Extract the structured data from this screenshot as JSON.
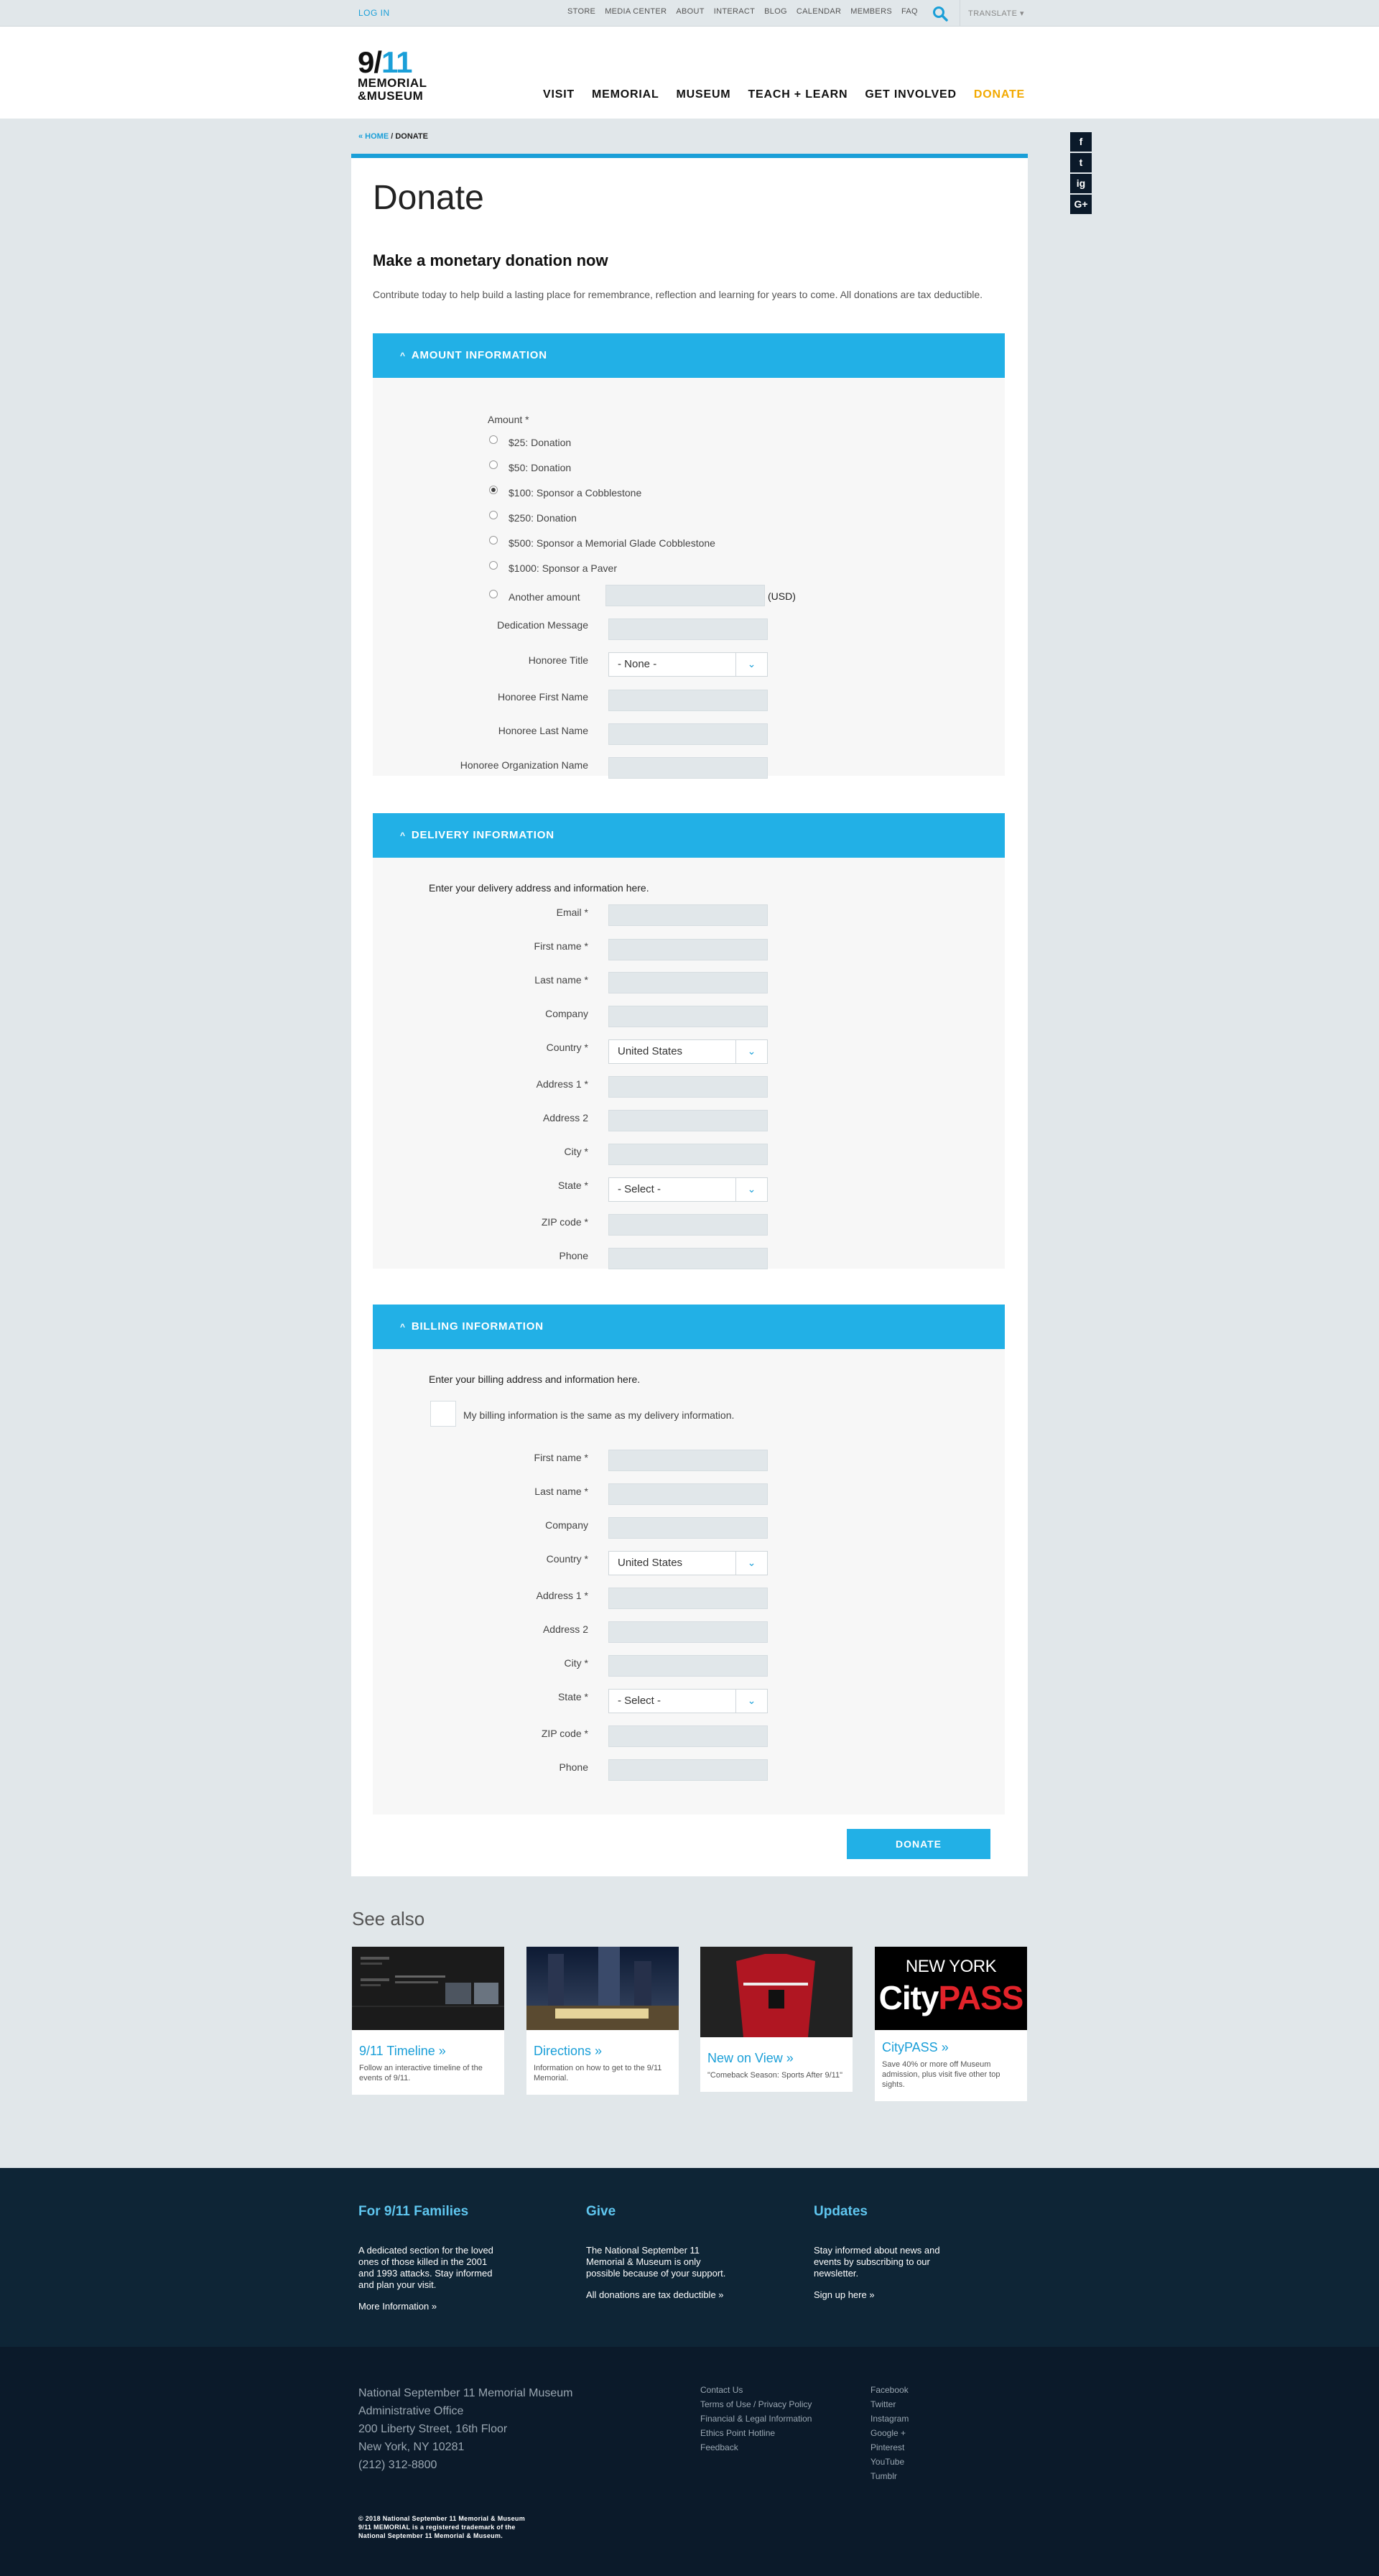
{
  "topbar": {
    "login": "LOG IN",
    "links": [
      "STORE",
      "MEDIA CENTER",
      "ABOUT",
      "INTERACT",
      "BLOG",
      "CALENDAR",
      "MEMBERS",
      "FAQ"
    ],
    "translate": "TRANSLATE ▾"
  },
  "logo": {
    "line1_a": "9/",
    "line1_b": "11",
    "line2": "MEMORIAL",
    "line3": "&MUSEUM"
  },
  "nav": [
    "VISIT",
    "MEMORIAL",
    "MUSEUM",
    "TEACH + LEARN",
    "GET INVOLVED"
  ],
  "nav_donate": "DONATE",
  "social": [
    "f",
    "t",
    "ig",
    "G+"
  ],
  "breadcrumb": {
    "home": "« HOME",
    "sep": " / ",
    "current": "DONATE"
  },
  "page": {
    "title": "Donate",
    "subtitle": "Make a monetary donation now",
    "intro": "Contribute today to help build a lasting place for remembrance, reflection and learning for years to come. All donations are tax deductible."
  },
  "amount": {
    "header": "AMOUNT INFORMATION",
    "label": "Amount *",
    "options": [
      "$25: Donation",
      "$50: Donation",
      "$100: Sponsor a Cobblestone",
      "$250: Donation",
      "$500: Sponsor a Memorial Glade Cobblestone",
      "$1000: Sponsor a Paver",
      "Another amount"
    ],
    "selected_index": 2,
    "currency": "(USD)",
    "dedication": "Dedication Message",
    "honoree_title": "Honoree Title",
    "honoree_title_value": "- None -",
    "honoree_first": "Honoree First Name",
    "honoree_last": "Honoree Last Name",
    "honoree_org": "Honoree Organization Name"
  },
  "delivery": {
    "header": "DELIVERY INFORMATION",
    "note": "Enter your delivery address and information here.",
    "email": "Email *",
    "first": "First name *",
    "last": "Last name *",
    "company": "Company",
    "country": "Country *",
    "country_value": "United States",
    "address1": "Address 1 *",
    "address2": "Address 2",
    "city": "City *",
    "state": "State *",
    "state_value": "- Select -",
    "zip": "ZIP code *",
    "phone": "Phone"
  },
  "billing": {
    "header": "BILLING INFORMATION",
    "note": "Enter your billing address and information here.",
    "same": "My billing information is the same as my delivery information.",
    "first": "First name *",
    "last": "Last name *",
    "company": "Company",
    "country": "Country *",
    "country_value": "United States",
    "address1": "Address 1 *",
    "address2": "Address 2",
    "city": "City *",
    "state": "State *",
    "state_value": "- Select -",
    "zip": "ZIP code *",
    "phone": "Phone"
  },
  "donate_button": "DONATE",
  "see_also": {
    "title": "See also",
    "tiles": [
      {
        "title": "9/11 Timeline »",
        "desc": "Follow an interactive timeline of the events of 9/11."
      },
      {
        "title": "Directions »",
        "desc": "Information on how to get to the 9/11 Memorial."
      },
      {
        "title": "New on View »",
        "desc": "\"Comeback Season: Sports After 9/11\""
      },
      {
        "title": "CityPASS »",
        "desc": "Save 40% or more off Museum admission, plus visit five other top sights."
      }
    ],
    "citypass_line1": "NEW YORK",
    "citypass_line2a": "City",
    "citypass_line2b": "PASS"
  },
  "footer": {
    "families": {
      "title": "For 9/11 Families",
      "text": "A dedicated section for the loved ones of those killed in the 2001 and 1993 attacks. Stay informed and plan your visit.",
      "link": "More Information »"
    },
    "give": {
      "title": "Give",
      "text": "The National September 11 Memorial & Museum is only possible because of your support.",
      "link": "All donations are tax deductible »"
    },
    "updates": {
      "title": "Updates",
      "text": "Stay informed about news and events by subscribing to our newsletter.",
      "link": "Sign up here »"
    },
    "address": [
      "National September 11 Memorial Museum",
      "Administrative Office",
      "200 Liberty Street, 16th Floor",
      "New York, NY 10281",
      "(212) 312-8800"
    ],
    "links1": [
      "Contact Us",
      "Terms of Use / Privacy Policy",
      "Financial & Legal Information",
      "Ethics Point Hotline",
      "Feedback"
    ],
    "links2": [
      "Facebook",
      "Twitter",
      "Instagram",
      "Google +",
      "Pinterest",
      "YouTube",
      "Tumblr"
    ],
    "copyright": [
      "© 2018 National September 11 Memorial & Museum",
      "9/11 MEMORIAL is a registered trademark of the",
      "National September 11 Memorial & Museum."
    ]
  }
}
